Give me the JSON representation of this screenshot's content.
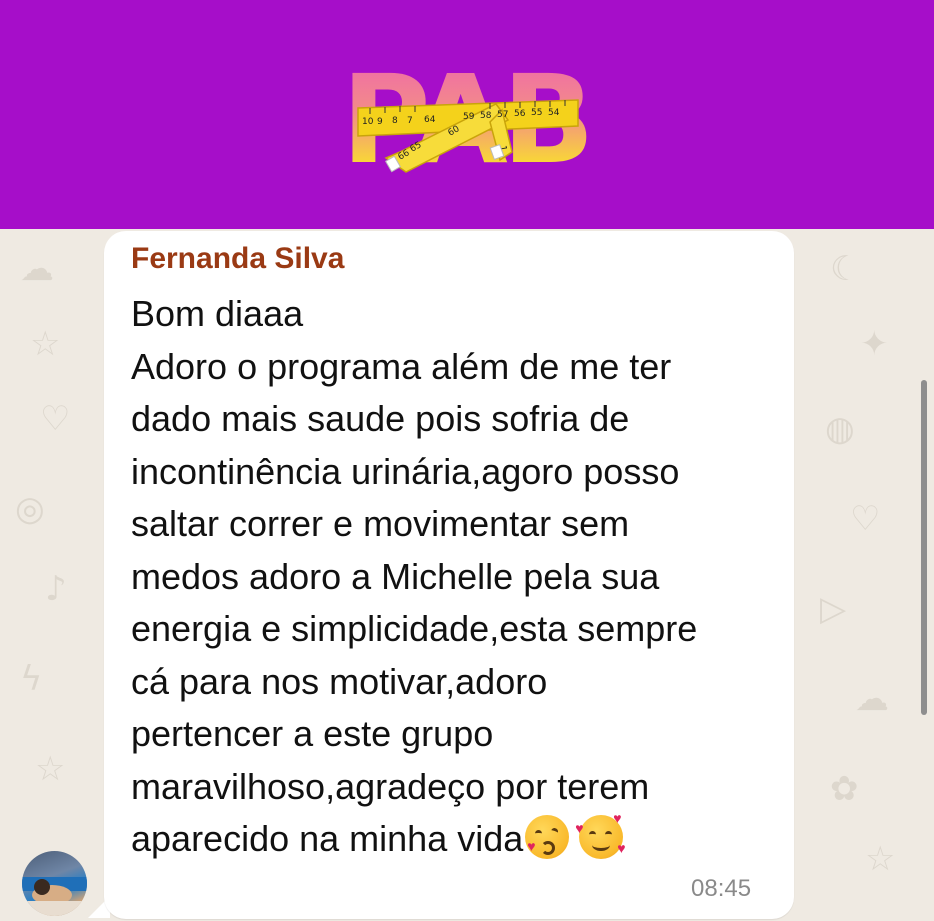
{
  "banner": {
    "background": "#a60ec9",
    "logo_text": "PAB",
    "tape_numbers": [
      "10",
      "9",
      "8",
      "7",
      "64",
      "65",
      "66",
      "60",
      "59",
      "58",
      "57",
      "56",
      "55",
      "54",
      "1"
    ]
  },
  "chat": {
    "background": "#efeae2",
    "message": {
      "sender": "Fernanda Silva",
      "sender_color": "#9a3a14",
      "lines": [
        "Bom diaaa",
        "Adoro o programa além de me ter",
        "dado mais saude pois sofria de",
        "incontinência urinária,agoro posso",
        "saltar correr e movimentar sem",
        "medos adoro a Michelle pela sua",
        "energia e simplicidade,esta sempre",
        "cá para nos motivar,adoro",
        "pertencer a este grupo",
        "maravilhoso,agradeço por terem",
        "aparecido na minha vida"
      ],
      "emojis": [
        "face-blowing-kiss-icon",
        "smiling-face-with-hearts-icon"
      ],
      "time": "08:45"
    }
  }
}
